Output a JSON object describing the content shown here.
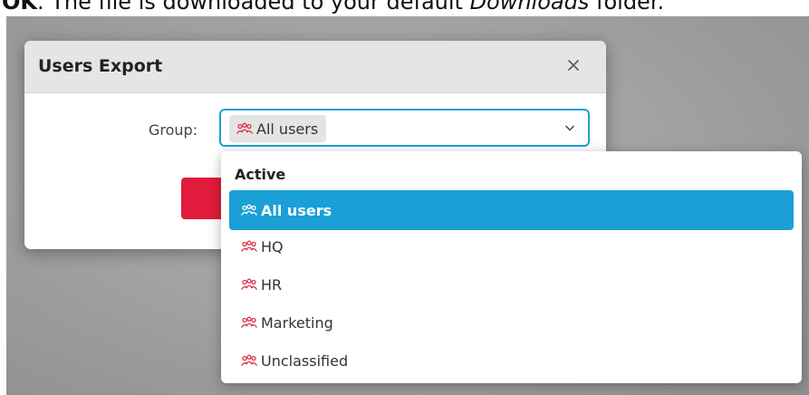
{
  "caption": {
    "bold": "OK",
    "pre": ". The file is downloaded to your default ",
    "italic": "Downloads",
    "post": " folder."
  },
  "dialog": {
    "title": "Users Export",
    "group_label": "Group:",
    "selected_value": "All users"
  },
  "dropdown": {
    "group_header": "Active",
    "options": [
      {
        "label": "All users",
        "selected": true
      },
      {
        "label": "HQ",
        "selected": false
      },
      {
        "label": "HR",
        "selected": false
      },
      {
        "label": "Marketing",
        "selected": false
      },
      {
        "label": "Unclassified",
        "selected": false
      }
    ]
  },
  "colors": {
    "accent_blue": "#1a9fd6",
    "brand_red": "#e21b3c",
    "group_icon": "#d8334a"
  },
  "icons": {
    "group": "users-group-icon",
    "close": "close-icon",
    "dropdown": "chevron-down-icon"
  }
}
